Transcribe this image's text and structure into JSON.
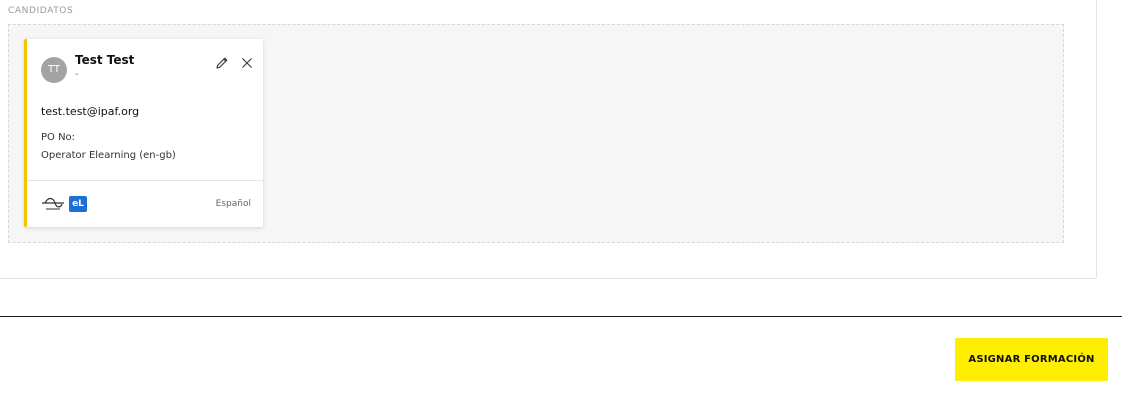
{
  "section": {
    "title": "CANDIDATOS"
  },
  "candidate": {
    "initials": "TT",
    "name": "Test Test",
    "subtitle": "-",
    "email": "test.test@ipaf.org",
    "po_label": "PO No:",
    "course": "Operator Elearning (en-gb)",
    "badge": "eL",
    "language": "Español",
    "icons": {
      "edit": "pencil-icon",
      "remove": "close-icon",
      "delivery": "strikethrough-path-icon"
    },
    "accent_color": "#f5c400",
    "badge_color": "#1e6ed8"
  },
  "footer": {
    "assign_label": "ASIGNAR FORMACIÓN",
    "button_color": "#ffee00"
  }
}
